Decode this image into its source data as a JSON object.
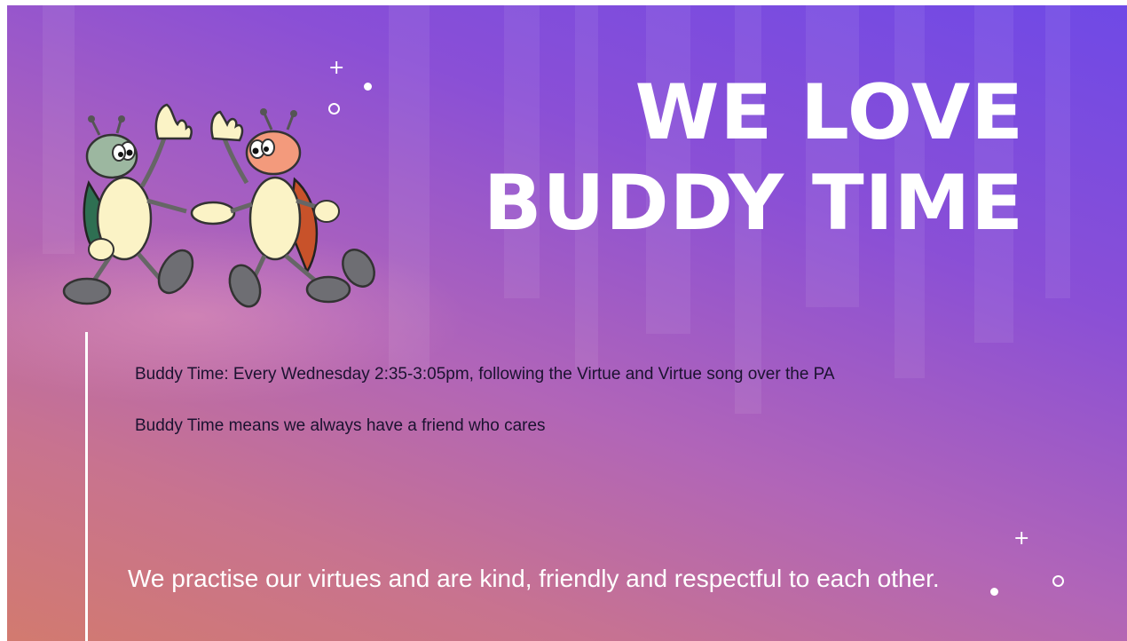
{
  "slide": {
    "title_line1": "WE LOVE",
    "title_line2": "BUDDY TIME",
    "body_line1": "Buddy Time: Every Wednesday 2:35-3:05pm, following the Virtue and Virtue song over the PA",
    "body_line2": "Buddy Time means we always have a friend who cares",
    "quote": "We practise our virtues and are kind, friendly and respectful to each other."
  },
  "illustration": "two-bugs-shaking-hands",
  "colors": {
    "gradient_top": "#6f49e6",
    "gradient_bottom": "#d27a6f",
    "title_text": "#ffffff",
    "body_text": "#1b1230"
  }
}
